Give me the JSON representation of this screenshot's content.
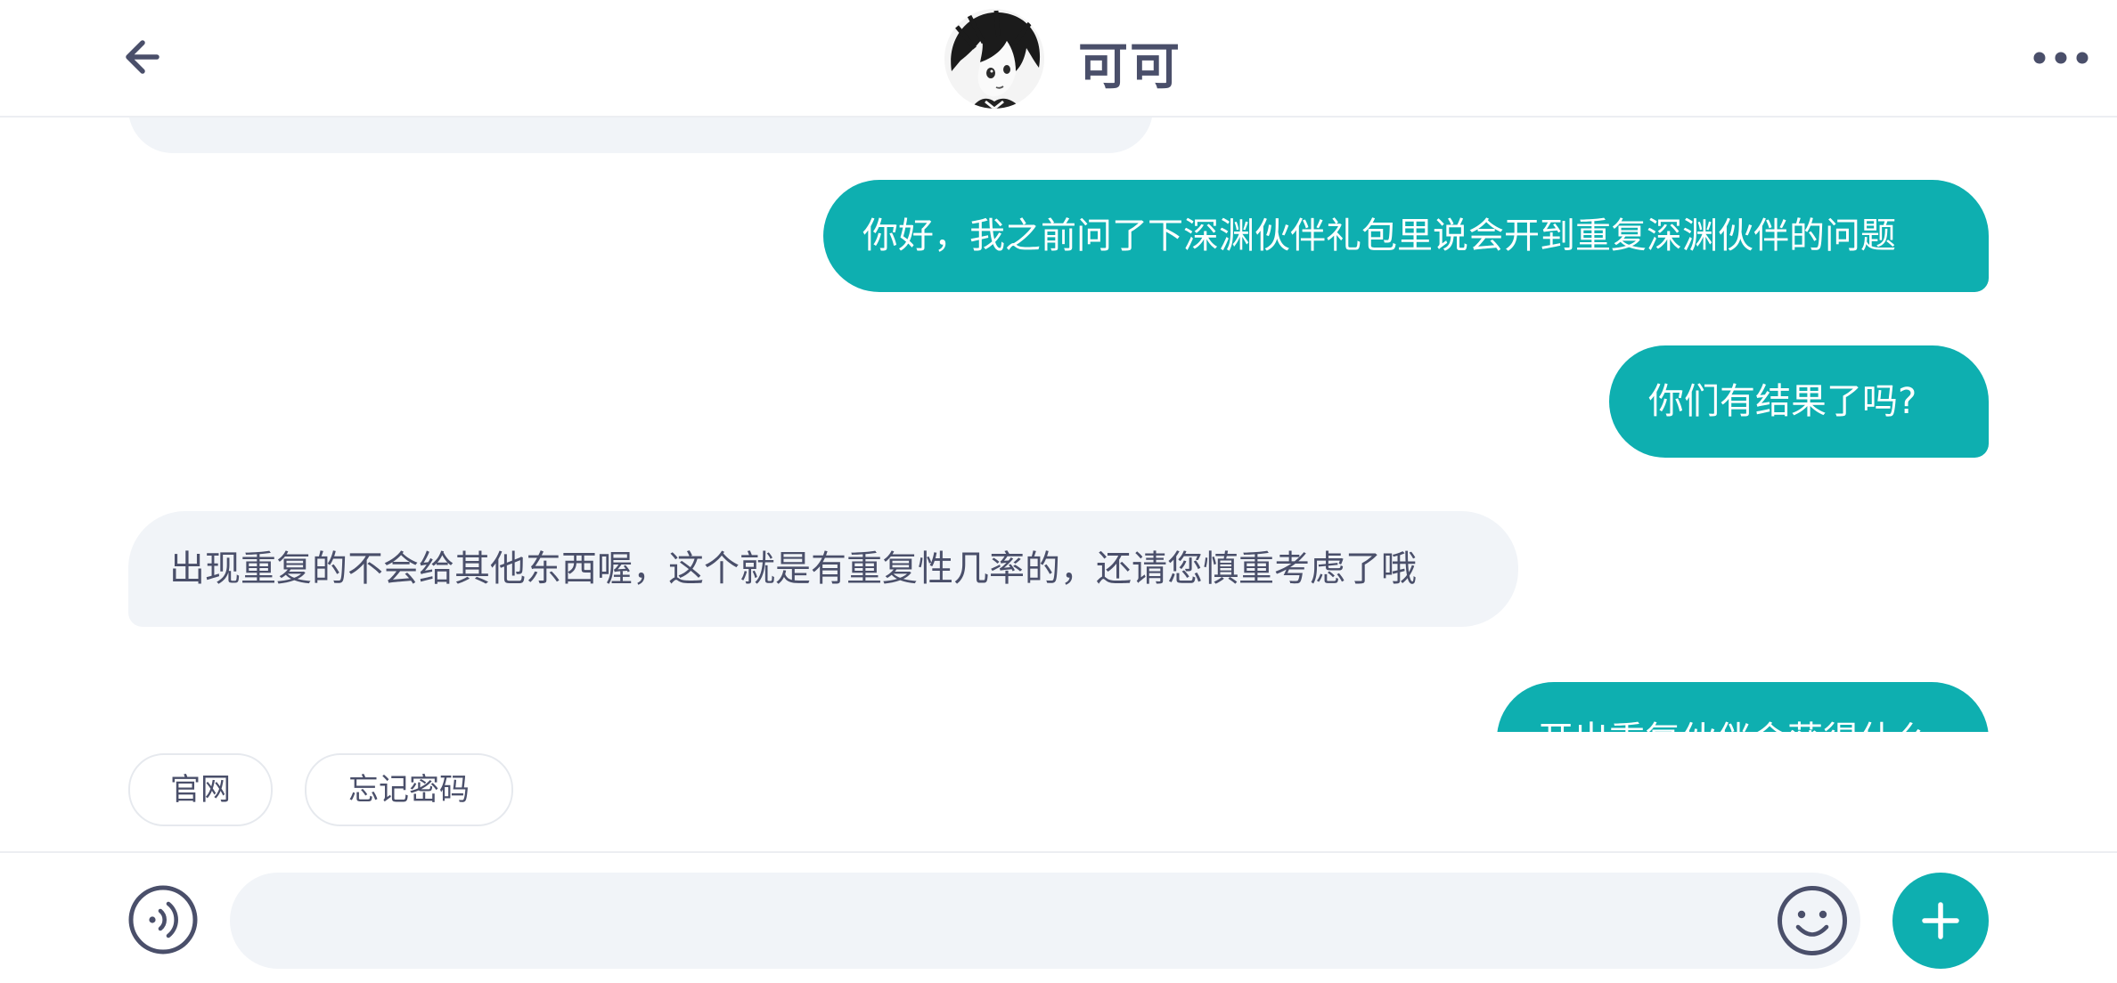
{
  "header": {
    "back_icon": "arrow-left-icon",
    "avatar_icon": "anime-avatar",
    "contact_name": "可可",
    "more_icon": "more-horizontal-icon"
  },
  "messages": [
    {
      "direction": "out",
      "text": "你好，我之前问了下深渊伙伴礼包里说会开到重复深渊伙伴的问题"
    },
    {
      "direction": "out",
      "text": "你们有结果了吗?"
    },
    {
      "direction": "in",
      "text": "出现重复的不会给其他东西喔，这个就是有重复性几率的，还请您慎重考虑了哦"
    },
    {
      "direction": "out",
      "text": "开出重复伙伴会获得什么"
    }
  ],
  "quick_replies": [
    {
      "label": "官网"
    },
    {
      "label": "忘记密码"
    }
  ],
  "input_bar": {
    "voice_icon": "voice-icon",
    "input_value": "",
    "input_placeholder": "",
    "emoji_icon": "emoji-icon",
    "plus_icon": "plus-icon"
  },
  "colors": {
    "accent": "#0eafb0",
    "incoming_bubble": "#f1f4f8",
    "text_dark": "#4a4f6a",
    "text_on_accent": "#ffffff"
  }
}
